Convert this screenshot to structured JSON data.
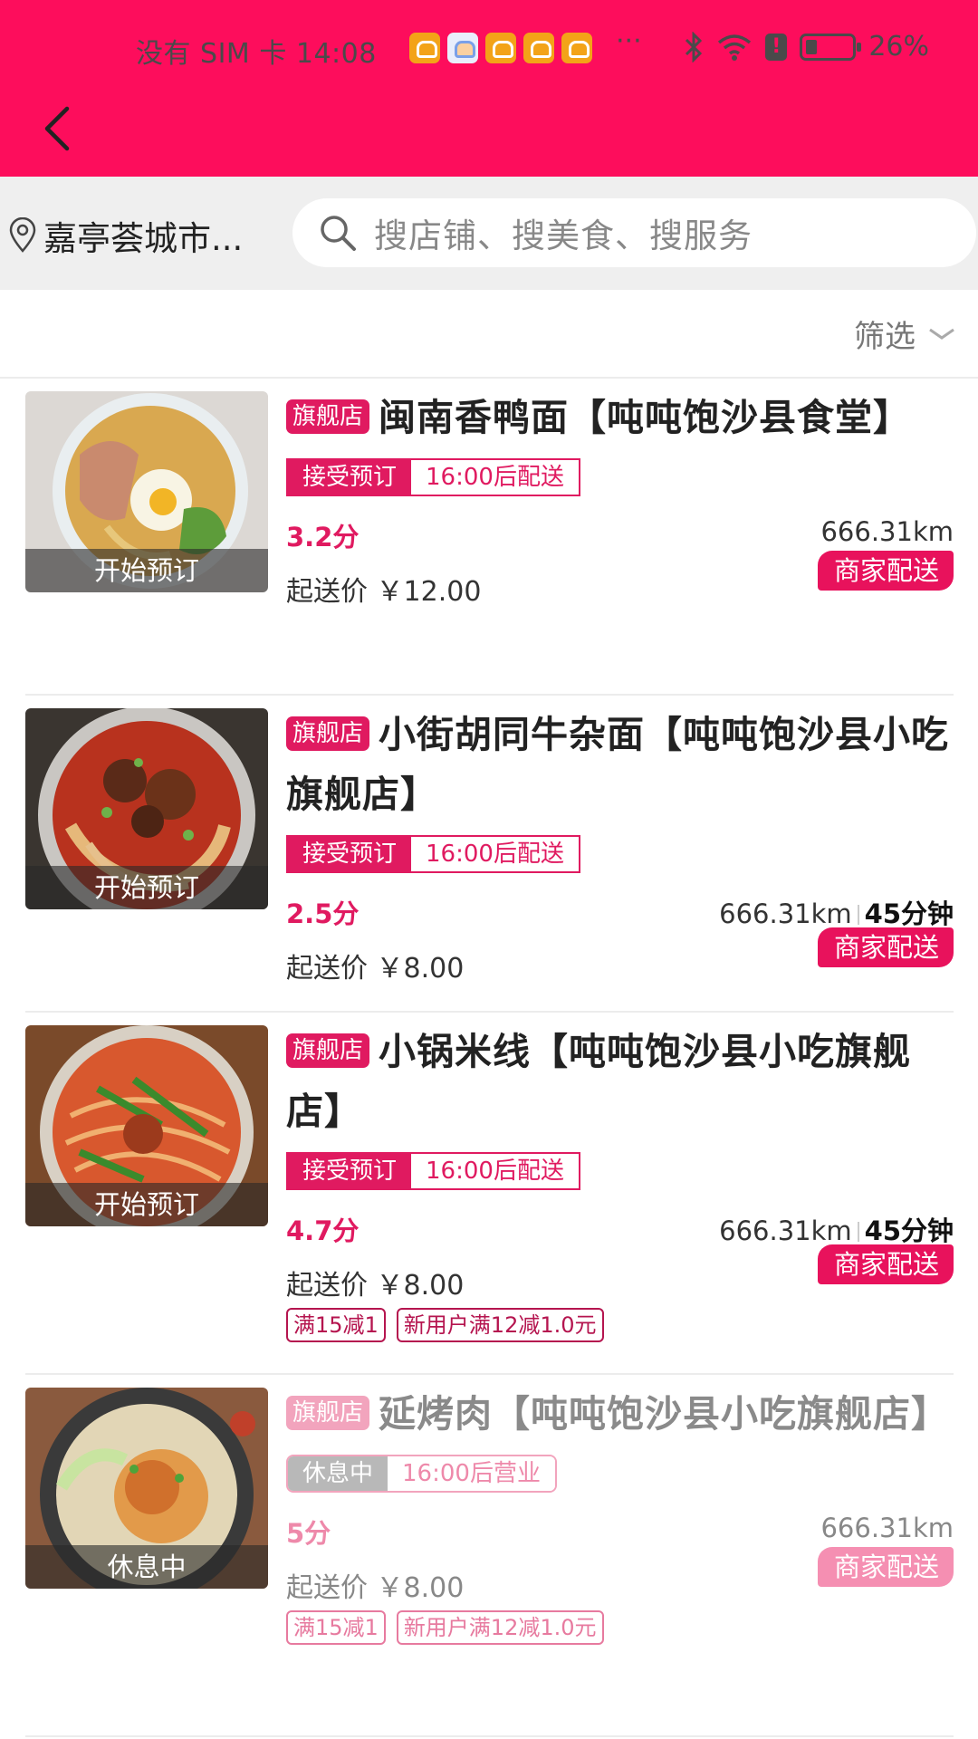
{
  "status_bar": {
    "left_text": "没有 SIM 卡 14:08",
    "more": "···",
    "battery": "26%"
  },
  "nav": {
    "back_icon": "chevron-left-icon"
  },
  "search": {
    "location": "嘉亭荟城市...",
    "placeholder": "搜店铺、搜美食、搜服务"
  },
  "filter": {
    "label": "筛选"
  },
  "colors": {
    "brand": "#fd0d5c",
    "accent": "#e01a60"
  },
  "shops": [
    {
      "badge": "开始预订",
      "flag": "旗舰店",
      "name": "闽南香鸭面【吨吨饱沙县食堂】",
      "tag_primary": "接受预订",
      "tag_secondary": "16:00后配送",
      "score": "3.2分",
      "distance": "666.31km",
      "time": "",
      "min_price": "起送价 ￥12.00",
      "delivery": "商家配送",
      "promos": []
    },
    {
      "badge": "开始预订",
      "flag": "旗舰店",
      "name": "小街胡同牛杂面【吨吨饱沙县小吃旗舰店】",
      "tag_primary": "接受预订",
      "tag_secondary": "16:00后配送",
      "score": "2.5分",
      "distance": "666.31km",
      "time": "45分钟",
      "min_price": "起送价 ￥8.00",
      "delivery": "商家配送",
      "promos": []
    },
    {
      "badge": "开始预订",
      "flag": "旗舰店",
      "name": "小锅米线【吨吨饱沙县小吃旗舰店】",
      "tag_primary": "接受预订",
      "tag_secondary": "16:00后配送",
      "score": "4.7分",
      "distance": "666.31km",
      "time": "45分钟",
      "min_price": "起送价 ￥8.00",
      "delivery": "商家配送",
      "promos": [
        "满15减1",
        "新用户满12减1.0元"
      ]
    },
    {
      "badge": "休息中",
      "flag": "旗舰店",
      "name": "延烤肉【吨吨饱沙县小吃旗舰店】",
      "tag_primary": "休息中",
      "tag_secondary": "16:00后营业",
      "score": "5分",
      "distance": "666.31km",
      "time": "",
      "min_price": "起送价 ￥8.00",
      "delivery": "商家配送",
      "promos": [
        "满15减1",
        "新用户满12减1.0元"
      ]
    }
  ]
}
